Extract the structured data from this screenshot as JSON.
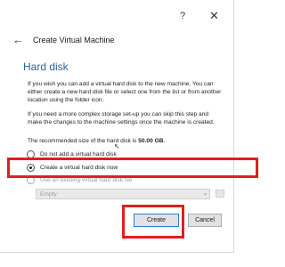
{
  "titlebar": {
    "help": "?",
    "close": "✕"
  },
  "dialog": {
    "title": "Create Virtual Machine",
    "back": "←"
  },
  "section": {
    "title": "Hard disk"
  },
  "paragraphs": {
    "p1": "If you wish you can add a virtual hard disk to the new machine. You can either create a new hard disk file or select one from the list or from another location using the folder icon.",
    "p2": "If you need a more complex storage set-up you can skip this step and make the changes to the machine settings once the machine is created.",
    "p3_prefix": "The recommended size of the hard disk is ",
    "p3_size": "50.00 GB",
    "p3_suffix": "."
  },
  "options": {
    "no_disk": "Do not add a virtual hard disk",
    "create_new": "Create a virtual hard disk now",
    "use_existing": "Use an existing virtual hard disk file"
  },
  "selected_option": "create_new",
  "disk_select": {
    "value": "Empty",
    "caret": "▾"
  },
  "buttons": {
    "create": "Create",
    "cancel": "Cancel"
  },
  "colors": {
    "accent": "#2c5f9e",
    "highlight": "#e01f1f",
    "focus": "#2a7fd4"
  }
}
